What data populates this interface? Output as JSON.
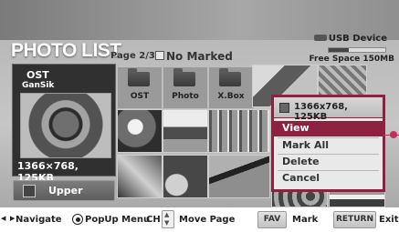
{
  "header": {
    "title": "PHOTO LIST",
    "page": "Page 2/3",
    "marked": "No Marked"
  },
  "device": {
    "label": "USB Device",
    "free_space": "Free Space 150MB",
    "usage_fraction": 0.35
  },
  "preview": {
    "title": "OST",
    "subtitle": "GanSik",
    "info": "1366×768, 125KB",
    "upper_label": "Upper"
  },
  "folders": [
    {
      "label": "OST"
    },
    {
      "label": "Photo"
    },
    {
      "label": "X.Box"
    }
  ],
  "popup": {
    "info": "1366x768, 125KB",
    "items": [
      "View",
      "Mark All",
      "Delete",
      "Cancel"
    ],
    "selected_index": 0
  },
  "footer": {
    "navigate": "Navigate",
    "popup_menu": "PopUp Menu",
    "ch": "CH",
    "move_page": "Move Page",
    "fav_key": "FAV",
    "mark": "Mark",
    "return_key": "RETURN",
    "exit": "Exit"
  },
  "colors": {
    "accent": "#8d2240",
    "pointer": "#c0305a"
  }
}
